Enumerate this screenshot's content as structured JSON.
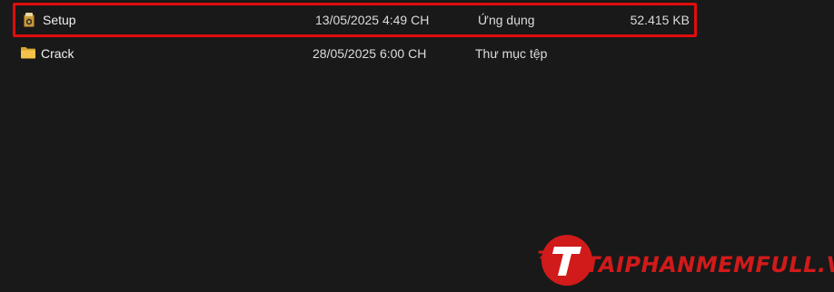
{
  "files": [
    {
      "name": "Setup",
      "date_modified": "13/05/2025 4:49 CH",
      "type": "Ứng dụng",
      "size": "52.415 KB",
      "icon": "installer-icon",
      "highlighted": true
    },
    {
      "name": "Crack",
      "date_modified": "28/05/2025 6:00 CH",
      "type": "Thư mục tệp",
      "size": "",
      "icon": "folder-icon",
      "highlighted": false
    }
  ],
  "colors": {
    "background": "#191919",
    "highlight_border": "#e00d0d",
    "folder_yellow": "#f3c34b",
    "watermark_red": "#d11a1a"
  },
  "watermark": {
    "text": "TAIPHANMEMFULL.VN"
  }
}
